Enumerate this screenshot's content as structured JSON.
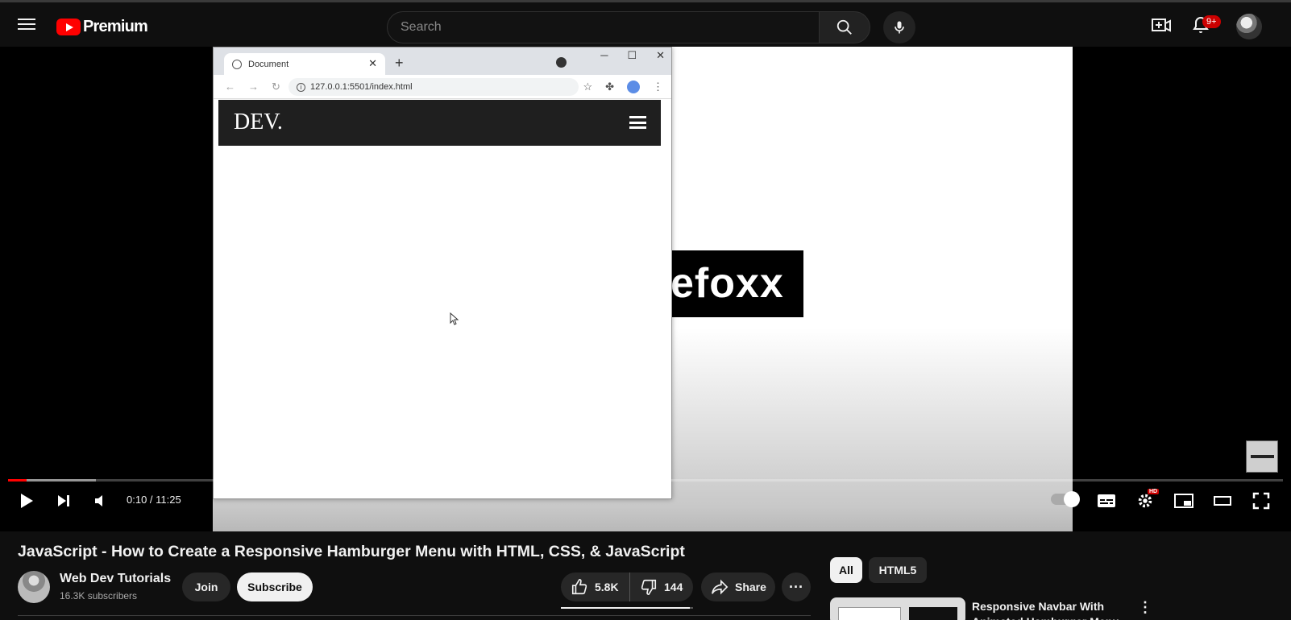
{
  "header": {
    "logo_text": "Premium",
    "search_placeholder": "Search",
    "notification_count": "9+",
    "icons": [
      "menu-icon",
      "youtube-logo-icon",
      "search-icon",
      "mic-icon",
      "create-icon",
      "bell-icon",
      "avatar"
    ]
  },
  "video_frame": {
    "browser": {
      "tab_title": "Document",
      "url": "127.0.0.1:5501/index.html",
      "site_logo": "DEV."
    },
    "brand_text": "efoxx"
  },
  "player": {
    "time_current": "0:10",
    "time_separator": " / ",
    "time_total": "11:25",
    "progress_played_fraction": 0.0146,
    "progress_loaded_fraction": 0.069,
    "hd_badge": "HD",
    "autoplay_on": true,
    "icons": [
      "play-icon",
      "next-icon",
      "volume-icon",
      "autoplay-toggle",
      "subtitles-icon",
      "settings-icon",
      "miniplayer-icon",
      "theater-icon",
      "fullscreen-icon"
    ]
  },
  "video": {
    "title": "JavaScript - How to Create a Responsive Hamburger Menu with HTML, CSS, & JavaScript",
    "channel_name": "Web Dev Tutorials",
    "subscribers": "16.3K subscribers",
    "join_label": "Join",
    "subscribe_label": "Subscribe",
    "likes": "5.8K",
    "dislikes": "144",
    "like_ratio": 0.976,
    "share_label": "Share",
    "more_label": "···"
  },
  "sidebar": {
    "chips": [
      {
        "label": "All",
        "selected": true
      },
      {
        "label": "HTML5",
        "selected": false
      }
    ],
    "recommendation": {
      "title": "Responsive Navbar With Animated Hamburger Menu"
    }
  },
  "colors": {
    "background": "#0f0f0f",
    "accent_red": "#ff0000",
    "button_bg": "#272727",
    "text": "#f1f1f1"
  }
}
